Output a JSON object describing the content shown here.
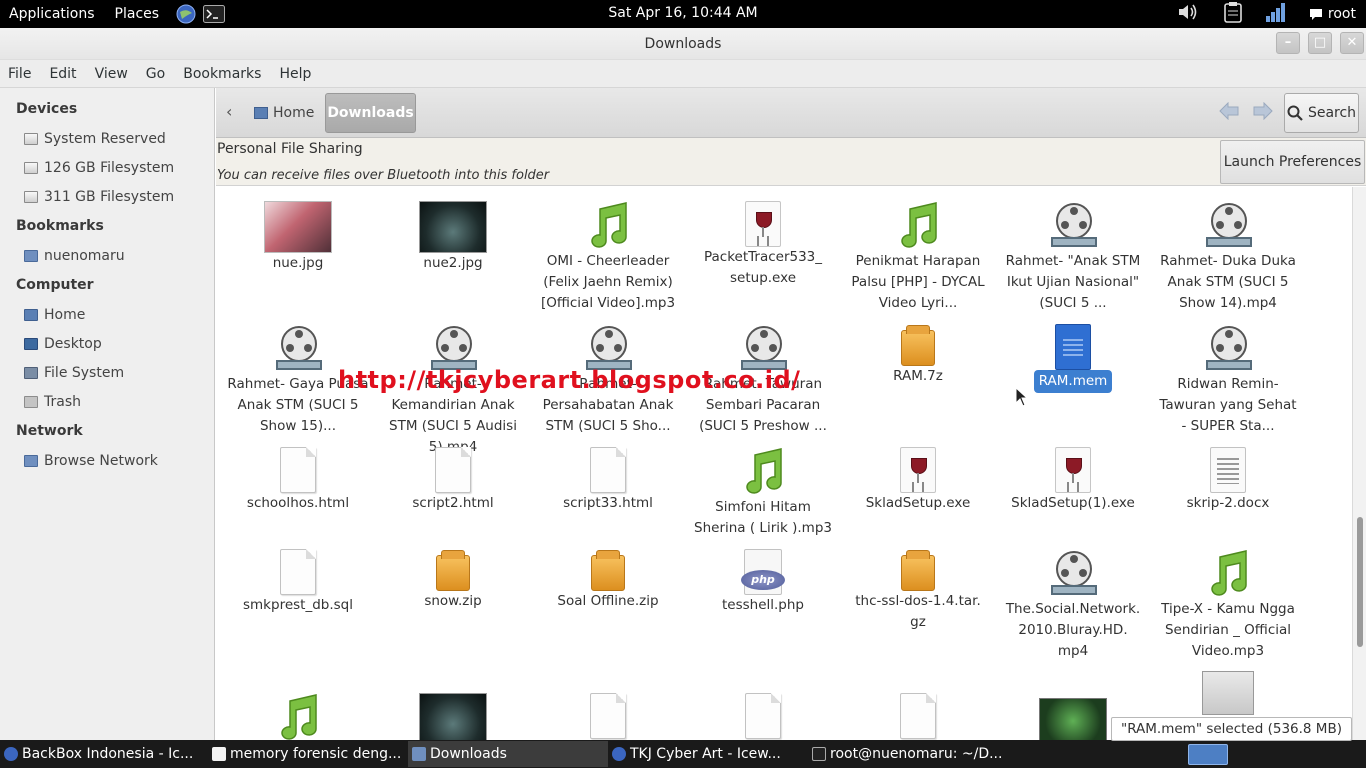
{
  "panel": {
    "applications": "Applications",
    "places": "Places",
    "clock": "Sat Apr 16, 10:44 AM",
    "user": "root"
  },
  "window": {
    "title": "Downloads"
  },
  "menubar": [
    "File",
    "Edit",
    "View",
    "Go",
    "Bookmarks",
    "Help"
  ],
  "sidebar": {
    "devices_header": "Devices",
    "devices": [
      "System Reserved",
      "126 GB Filesystem",
      "311 GB Filesystem"
    ],
    "bookmarks_header": "Bookmarks",
    "bookmarks": [
      "nuenomaru"
    ],
    "computer_header": "Computer",
    "computer": [
      "Home",
      "Desktop",
      "File System",
      "Trash"
    ],
    "network_header": "Network",
    "network": [
      "Browse Network"
    ]
  },
  "location": {
    "home": "Home",
    "current": "Downloads",
    "search": "Search"
  },
  "infobar": {
    "title": "Personal File Sharing",
    "desc": "You can receive files over Bluetooth into this folder",
    "button": "Launch Preferences"
  },
  "files": [
    "nue.jpg",
    "nue2.jpg",
    "OMI - Cheerleader (Felix Jaehn Remix) [Official Video].mp3",
    "PacketTracer533_ setup.exe",
    "Penikmat Harapan Palsu [PHP] - DYCAL Video Lyri...",
    "Rahmet- \"Anak STM Ikut Ujian Nasional\" (SUCI 5 ...",
    "Rahmet- Duka Duka Anak STM (SUCI 5 Show 14).mp4",
    "Rahmet- Gaya Puasa Anak STM (SUCI 5 Show 15)...",
    "Rahmet- Kemandirian Anak STM (SUCI 5 Audisi 5).mp4",
    "Rahmet- Persahabatan Anak STM (SUCI 5 Sho...",
    "Rahmet- Tawuran Sembari Pacaran (SUCI 5 Preshow ...",
    "RAM.7z",
    "RAM.mem",
    "Ridwan Remin- Tawuran yang Sehat - SUPER Sta...",
    "schoolhos.html",
    "script2.html",
    "script33.html",
    "Simfoni Hitam Sherina ( Lirik ).mp3",
    "SkladSetup.exe",
    "SkladSetup(1).exe",
    "skrip-2.docx",
    "smkprest_db.sql",
    "snow.zip",
    "Soal Offline.zip",
    "tesshell.php",
    "thc-ssl-dos-1.4.tar. gz",
    "The.Social.Network. 2010.Bluray.HD. mp4",
    "Tipe-X - Kamu Ngga Sendirian _ Official Video.mp3"
  ],
  "watermark": "http://tkjcyberart.blogspot.co.id/",
  "status": "\"RAM.mem\" selected (536.8 MB)",
  "taskbar": [
    "BackBox Indonesia - Ic...",
    "memory forensic deng...",
    "Downloads",
    "TKJ Cyber Art - Icew...",
    "root@nuenomaru: ~/D..."
  ],
  "php_badge": "php",
  "colors": {
    "selection": "#3c7fd0",
    "watermark": "#e0101e",
    "panel": "#000000"
  }
}
